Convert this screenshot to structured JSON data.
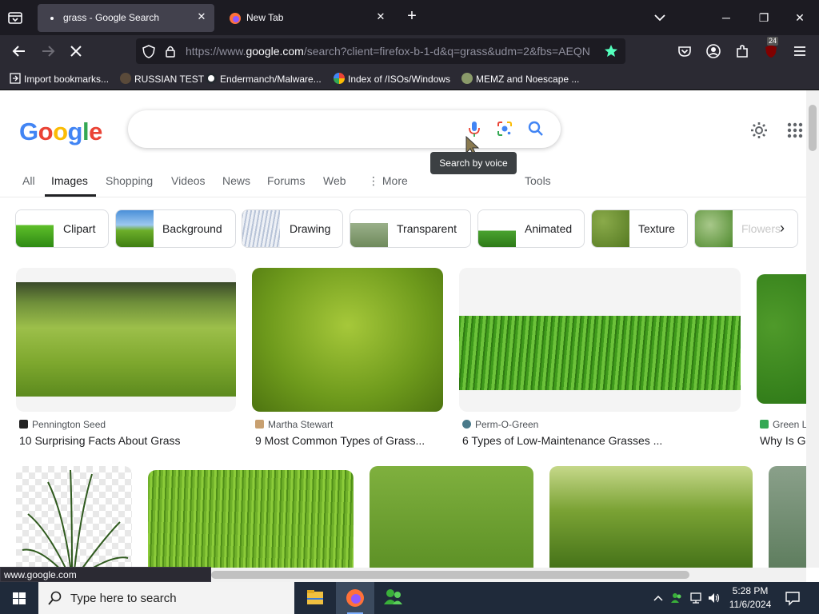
{
  "browser": {
    "tabs": [
      {
        "title": "grass - Google Search",
        "active": true
      },
      {
        "title": "New Tab",
        "active": false
      }
    ],
    "url": {
      "prefix": "https://www.",
      "domain": "google.com",
      "rest": "/search?client=firefox-b-1-d&q=grass&udm=2&fbs=AEQN"
    },
    "extension_badge": "24",
    "bookmarks": [
      {
        "label": "Import bookmarks...",
        "icon": "import-icon"
      },
      {
        "label": "RUSSIAN TEST",
        "icon": "site-icon"
      },
      {
        "label": "Endermanch/Malware...",
        "icon": "github-icon"
      },
      {
        "label": "Index of /ISOs/Windows",
        "icon": "globe-icon"
      },
      {
        "label": "MEMZ and Noescape ...",
        "icon": "site-icon"
      }
    ],
    "status_url": "www.google.com"
  },
  "google": {
    "logo": "Google",
    "search_value": "",
    "tooltip": "Search by voice",
    "tabs": [
      "All",
      "Images",
      "Shopping",
      "Videos",
      "News",
      "Forums",
      "Web",
      "More",
      "Tools"
    ],
    "active_tab": "Images",
    "chips": [
      "Clipart",
      "Background",
      "Drawing",
      "Transparent",
      "Animated",
      "Texture",
      "Flowers"
    ],
    "results_row1": [
      {
        "source": "Pennington Seed",
        "title": "10 Surprising Facts About Grass"
      },
      {
        "source": "Martha Stewart",
        "title": "9 Most Common Types of Grass..."
      },
      {
        "source": "Perm-O-Green",
        "title": "6 Types of Low-Maintenance Grasses ..."
      },
      {
        "source": "Green L",
        "title": "Why Is G"
      }
    ]
  },
  "taskbar": {
    "search_placeholder": "Type here to search",
    "time": "5:28 PM",
    "date": "11/6/2024"
  },
  "colors": {
    "google_blue": "#4285f4",
    "google_red": "#ea4335",
    "google_yellow": "#fbbc05",
    "google_green": "#34a853",
    "firefox_dark": "#1c1b22",
    "bookmark_star": "#54ffbd"
  }
}
